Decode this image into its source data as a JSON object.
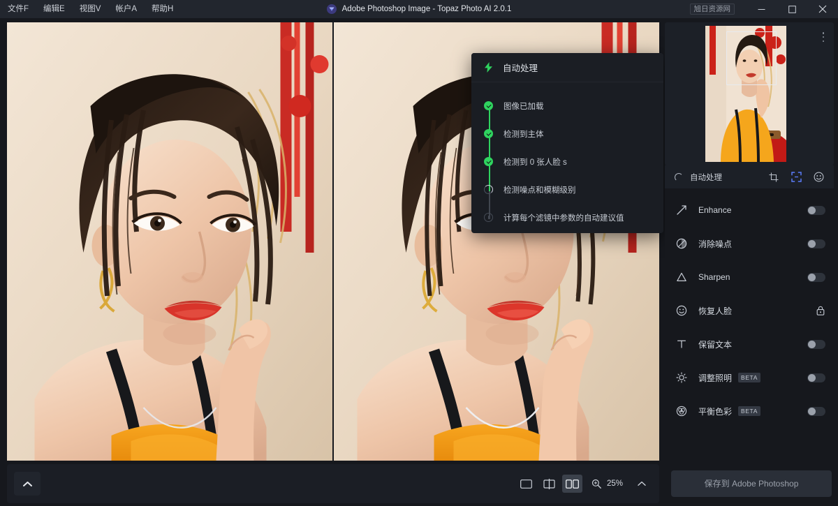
{
  "window": {
    "title": "Adobe Photoshop Image - Topaz Photo AI 2.0.1",
    "watermark_label": "旭日资源网",
    "minimize_icon": "minimize-icon",
    "maximize_icon": "maximize-icon",
    "close_icon": "close-icon",
    "logo_icon": "topaz-logo-icon"
  },
  "menu": {
    "items": [
      {
        "label": "文件F",
        "name": "menu-file"
      },
      {
        "label": "编辑E",
        "name": "menu-edit"
      },
      {
        "label": "视图V",
        "name": "menu-view"
      },
      {
        "label": "帐户A",
        "name": "menu-account"
      },
      {
        "label": "帮助H",
        "name": "menu-help"
      }
    ]
  },
  "progress_panel": {
    "header_icon": "lightning-bolt-icon",
    "title": "自动处理",
    "steps": [
      {
        "label": "图像已加载",
        "state": "done"
      },
      {
        "label": "检测到主体",
        "state": "done"
      },
      {
        "label": "检测到 0 张人脸 s",
        "state": "done"
      },
      {
        "label": "检测噪点和模糊级别",
        "state": "running"
      },
      {
        "label": "计算每个滤镜中参数的自动建议值",
        "state": "pending"
      }
    ]
  },
  "sidebar": {
    "navigator": {
      "kebab_icon": "more-options-icon",
      "viewport_name": "navigator-viewport-rect"
    },
    "header": {
      "spinner_icon": "loading-spinner-icon",
      "label": "自动处理",
      "actions": [
        {
          "name": "crop-icon",
          "active": false
        },
        {
          "name": "fit-to-screen-icon",
          "active": true
        },
        {
          "name": "face-detect-icon",
          "active": false
        }
      ]
    },
    "filters": [
      {
        "label": "Enhance",
        "icon": "enhance-arrow-icon",
        "control": "toggle",
        "enabled": false,
        "beta": false
      },
      {
        "label": "消除噪点",
        "icon": "denoise-circle-icon",
        "control": "toggle",
        "enabled": false,
        "beta": false
      },
      {
        "label": "Sharpen",
        "icon": "sharpen-triangle-icon",
        "control": "toggle",
        "enabled": false,
        "beta": false
      },
      {
        "label": "恢复人脸",
        "icon": "face-recovery-icon",
        "control": "lock",
        "enabled": false,
        "beta": false
      },
      {
        "label": "保留文本",
        "icon": "text-preserve-icon",
        "control": "toggle",
        "enabled": false,
        "beta": false
      },
      {
        "label": "调整照明",
        "icon": "lighting-sun-icon",
        "control": "toggle",
        "enabled": false,
        "beta": true
      },
      {
        "label": "平衡色彩",
        "icon": "color-balance-icon",
        "control": "toggle",
        "enabled": false,
        "beta": true
      }
    ],
    "beta_badge": "BETA"
  },
  "bottom_bar": {
    "collapse_icon": "chevron-up-icon",
    "view_modes": [
      {
        "name": "view-single",
        "icon": "single-view-icon",
        "active": false
      },
      {
        "name": "view-split",
        "icon": "split-view-icon",
        "active": false
      },
      {
        "name": "view-side-by-side",
        "icon": "side-by-side-view-icon",
        "active": true
      }
    ],
    "zoom_icon": "magnifier-icon",
    "zoom_level": "25%",
    "zoom_caret_icon": "chevron-up-icon",
    "save_label": "保存到 Adobe Photoshop"
  },
  "colors": {
    "accent_green": "#2fd35f",
    "accent_blue": "#5b7cfa",
    "titlebar_bg": "#22262e",
    "app_bg": "#16181d",
    "panel_bg": "#1c2027"
  }
}
